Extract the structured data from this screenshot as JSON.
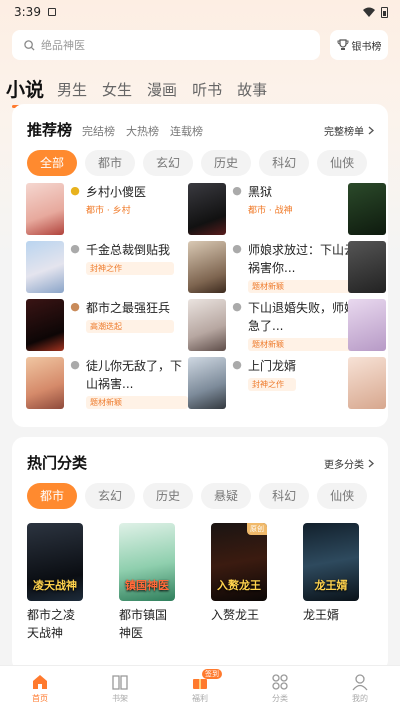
{
  "status": {
    "time": "3:39"
  },
  "search": {
    "placeholder": "绝品神医",
    "rank_label": "银书榜"
  },
  "tabs": [
    "小说",
    "男生",
    "女生",
    "漫画",
    "听书",
    "故事"
  ],
  "ranking": {
    "title": "推荐榜",
    "subtabs": [
      "完结榜",
      "大热榜",
      "连载榜"
    ],
    "more": "完整榜单",
    "chips": [
      "全部",
      "都市",
      "玄幻",
      "历史",
      "科幻",
      "仙侠"
    ],
    "items": [
      {
        "name": "乡村小傻医",
        "meta": "都市 · 乡村",
        "tag": ""
      },
      {
        "name": "黑狱",
        "meta": "都市 · 战神",
        "tag": ""
      },
      {
        "name": "千金总裁倒贴我",
        "meta": "",
        "tag": "封神之作"
      },
      {
        "name": "师娘求放过：下山云祸害你...",
        "meta": "",
        "tag": "题材新颖"
      },
      {
        "name": "都市之最强狂兵",
        "meta": "",
        "tag": "高潮迭起"
      },
      {
        "name": "下山退婚失败，师娘急了...",
        "meta": "",
        "tag": "题材新颖"
      },
      {
        "name": "徒儿你无敌了，下山祸害...",
        "meta": "",
        "tag": "题材新颖"
      },
      {
        "name": "上门龙婿",
        "meta": "",
        "tag": "封神之作"
      }
    ]
  },
  "categories": {
    "title": "热门分类",
    "more": "更多分类",
    "chips": [
      "都市",
      "玄幻",
      "历史",
      "悬疑",
      "科幻",
      "仙侠"
    ],
    "books": [
      {
        "name": "都市之凌天战神",
        "cover_text": "凌天战神",
        "badge": ""
      },
      {
        "name": "都市镇国神医",
        "cover_text": "镇国神医",
        "badge": ""
      },
      {
        "name": "入赘龙王",
        "cover_text": "入赘龙王",
        "badge": "原创"
      },
      {
        "name": "龙王婿",
        "cover_text": "龙王婿",
        "badge": ""
      }
    ]
  },
  "nav": [
    {
      "label": "首页",
      "icon": "home-icon"
    },
    {
      "label": "书架",
      "icon": "book-icon"
    },
    {
      "label": "福利",
      "icon": "gift-icon",
      "badge": "签到"
    },
    {
      "label": "分类",
      "icon": "grid-icon"
    },
    {
      "label": "我的",
      "icon": "user-icon"
    }
  ],
  "colors": {
    "accent": "#ff8a2f"
  }
}
